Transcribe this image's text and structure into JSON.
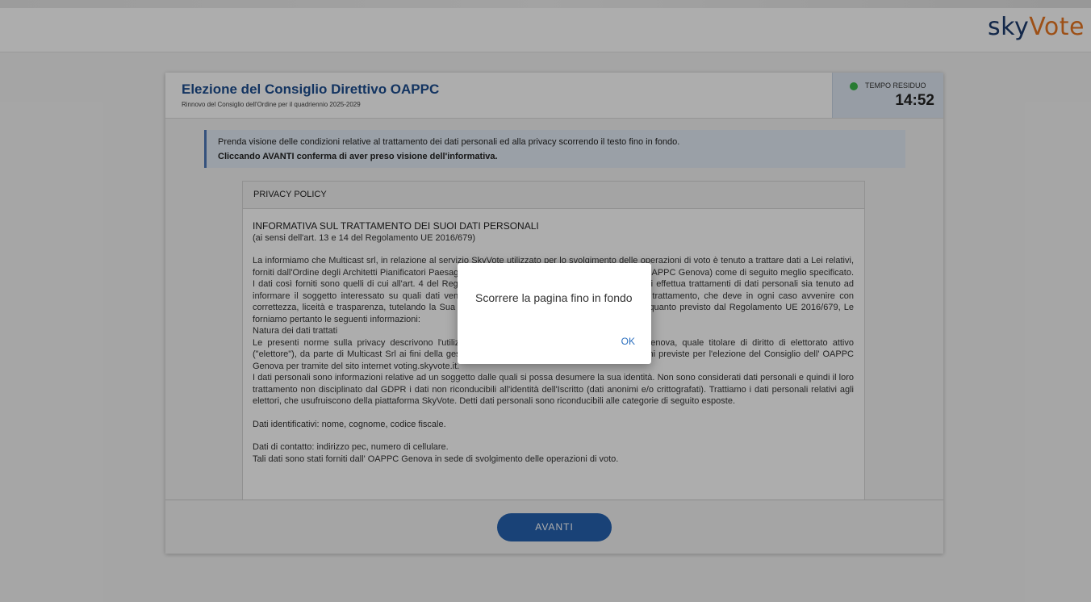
{
  "header": {
    "logo_part1": "sky",
    "logo_part2": "Vote"
  },
  "election": {
    "title": "Elezione del Consiglio Direttivo OAPPC",
    "subtitle": "Rinnovo del Consiglio dell'Ordine per il quadriennio 2025-2029"
  },
  "timer": {
    "label": "TEMPO RESIDUO",
    "value": "14:52",
    "status_color": "#3bb54a"
  },
  "notice": {
    "line1": "Prenda visione delle condizioni relative al trattamento dei dati personali ed alla privacy scorrendo il testo fino in fondo.",
    "line2": "Cliccando AVANTI conferma di aver preso visione dell'informativa."
  },
  "policy": {
    "header": "PRIVACY POLICY",
    "title": "INFORMATIVA SUL TRATTAMENTO DEI SUOI DATI PERSONALI",
    "subtitle": "(ai sensi dell'art. 13 e 14 del Regolamento UE 2016/679)",
    "para1": "La informiamo che Multicast srl, in relazione al servizio SkyVote utilizzato per lo svolgimento delle operazioni di voto è tenuto a trattare dati a Lei relativi, forniti dall'Ordine degli Architetti Pianificatori Paesaggisti e Conservatori della Provincia di Genova (OAPPC Genova) come di seguito meglio specificato. I dati così forniti sono quelli di cui all'art. 4 del Regolamento UE 2016/679, il quale prevede che chi effettua trattamenti di dati personali sia tenuto ad informare il soggetto interessato su quali dati vengano trattati e su taluni elementi qualificanti il trattamento, che deve in ogni caso avvenire con correttezza, liceità e trasparenza, tutelando la Sua riservatezza ed i Suoi diritti. Conformemente a quanto previsto dal Regolamento UE 2016/679, Le forniamo pertanto le seguenti informazioni:",
    "section_title": "Natura dei dati trattati",
    "para2": "Le presenti norme sulla privacy descrivono l'utilizzo dei dati personali dell'Iscritto all'OAPPC Genova, quale titolare di diritto di elettorato attivo (\"elettore\"), da parte di Multicast Srl ai fini della gestione del servizio di svolgimento delle operazioni previste per l'elezione del Consiglio dell' OAPPC Genova per tramite del sito internet voting.skyvote.it.",
    "para3": "I dati personali sono informazioni relative ad un soggetto dalle quali si possa desumere la sua identità. Non sono considerati dati personali e quindi il loro trattamento non disciplinato dal GDPR i dati non riconducibili all'identità dell'Iscritto (dati anonimi e/o crittografati). Trattiamo i dati personali relativi agli elettori, che usufruiscono della piattaforma SkyVote. Detti dati personali sono riconducibili alle categorie di seguito esposte.",
    "para4": "Dati identificativi: nome, cognome, codice fiscale.",
    "para5": "Dati di contatto: indirizzo pec, numero di cellulare.",
    "para6": "Tali dati sono stati forniti dall' OAPPC Genova in sede di svolgimento delle operazioni di voto."
  },
  "footer": {
    "next_label": "AVANTI"
  },
  "dialog": {
    "message": "Scorrere la pagina fino in fondo",
    "ok_label": "OK"
  },
  "colors": {
    "brand_blue": "#1c4d8f",
    "button_blue": "#2562b0",
    "logo_orange": "#e87722"
  }
}
